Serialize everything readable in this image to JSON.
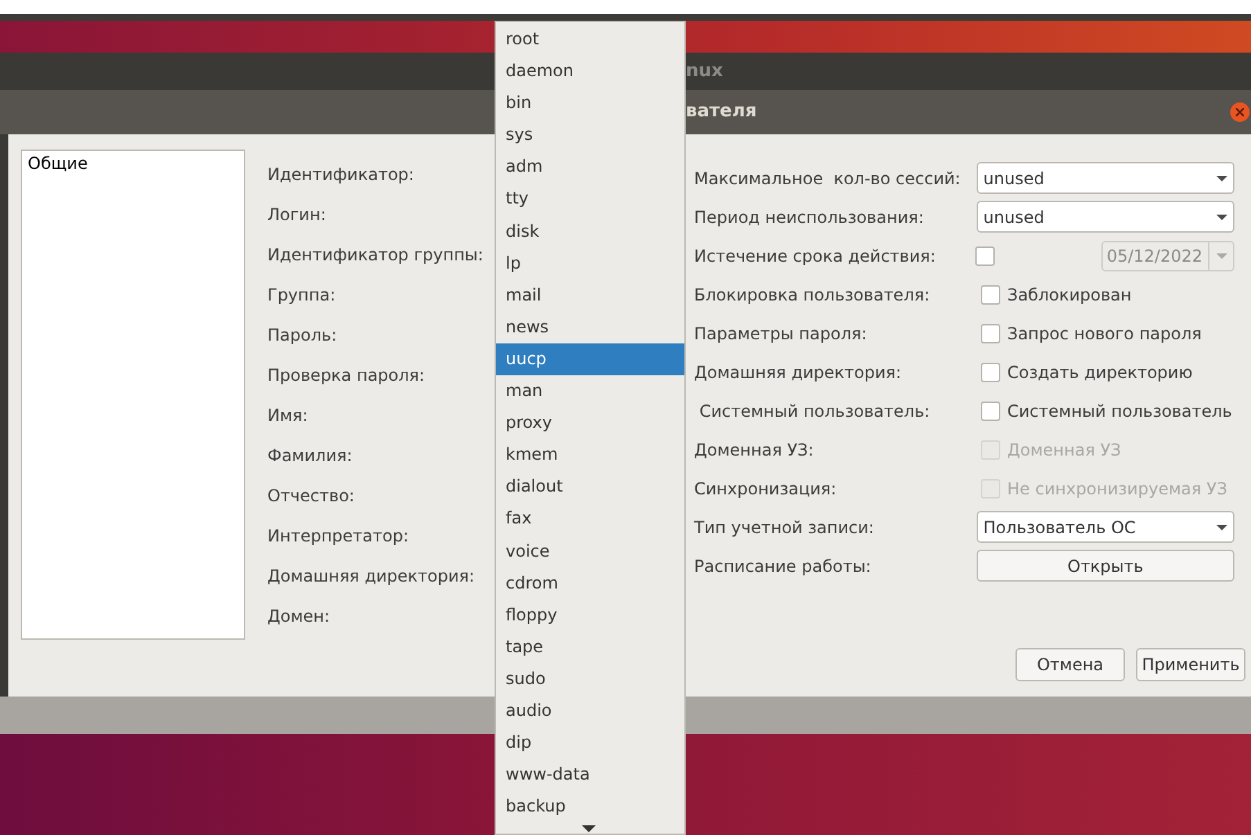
{
  "background_window": {
    "title": "nux"
  },
  "dialog": {
    "title": "вателя",
    "sidebar": {
      "items": [
        {
          "label": "Общие"
        }
      ]
    },
    "left_fields": [
      "Идентификатор:",
      "Логин:",
      "Идентификатор группы:",
      "Группа:",
      "Пароль:",
      "Проверка пароля:",
      "Имя:",
      "Фамилия:",
      "Отчество:",
      "Интерпретатор:",
      "Домашняя директория:",
      "Домен:"
    ],
    "right_fields": [
      {
        "kind": "combo",
        "label": "Максимальное  кол-во сессий:",
        "value": "unused"
      },
      {
        "kind": "combo",
        "label": "Период неиспользования:",
        "value": "unused"
      },
      {
        "kind": "date",
        "label": "Истечение срока действия:",
        "checked": false,
        "date": "05/12/2022",
        "disabled": true
      },
      {
        "kind": "checkbox",
        "label": "Блокировка пользователя:",
        "checked": false,
        "text": "Заблокирован",
        "disabled": false
      },
      {
        "kind": "checkbox",
        "label": "Параметры пароля:",
        "checked": false,
        "text": "Запрос нового пароля",
        "disabled": false
      },
      {
        "kind": "checkbox",
        "label": "Домашняя директория:",
        "checked": false,
        "text": "Создать директорию",
        "disabled": false
      },
      {
        "kind": "checkbox",
        "label": " Системный пользователь:",
        "checked": false,
        "text": "Системный пользователь",
        "disabled": false
      },
      {
        "kind": "checkbox",
        "label": "Доменная УЗ:",
        "checked": false,
        "text": "Доменная УЗ",
        "disabled": true
      },
      {
        "kind": "checkbox",
        "label": "Синхронизация:",
        "checked": false,
        "text": "Не синхронизируемая УЗ",
        "disabled": true
      },
      {
        "kind": "combo",
        "label": "Тип учетной записи:",
        "value": "Пользователь ОС"
      },
      {
        "kind": "button",
        "label": "Расписание работы:",
        "text": "Открыть"
      }
    ],
    "buttons": [
      "Отмена",
      "Применить"
    ]
  },
  "popup_menu": {
    "items": [
      {
        "label": "root",
        "selected": false
      },
      {
        "label": "daemon",
        "selected": false
      },
      {
        "label": "bin",
        "selected": false
      },
      {
        "label": "sys",
        "selected": false
      },
      {
        "label": "adm",
        "selected": false
      },
      {
        "label": "tty",
        "selected": false
      },
      {
        "label": "disk",
        "selected": false
      },
      {
        "label": "lp",
        "selected": false
      },
      {
        "label": "mail",
        "selected": false
      },
      {
        "label": "news",
        "selected": false
      },
      {
        "label": "uucp",
        "selected": true
      },
      {
        "label": "man",
        "selected": false
      },
      {
        "label": "proxy",
        "selected": false
      },
      {
        "label": "kmem",
        "selected": false
      },
      {
        "label": "dialout",
        "selected": false
      },
      {
        "label": "fax",
        "selected": false
      },
      {
        "label": "voice",
        "selected": false
      },
      {
        "label": "cdrom",
        "selected": false
      },
      {
        "label": "floppy",
        "selected": false
      },
      {
        "label": "tape",
        "selected": false
      },
      {
        "label": "sudo",
        "selected": false
      },
      {
        "label": "audio",
        "selected": false
      },
      {
        "label": "dip",
        "selected": false
      },
      {
        "label": "www-data",
        "selected": false
      },
      {
        "label": "backup",
        "selected": false
      }
    ]
  }
}
